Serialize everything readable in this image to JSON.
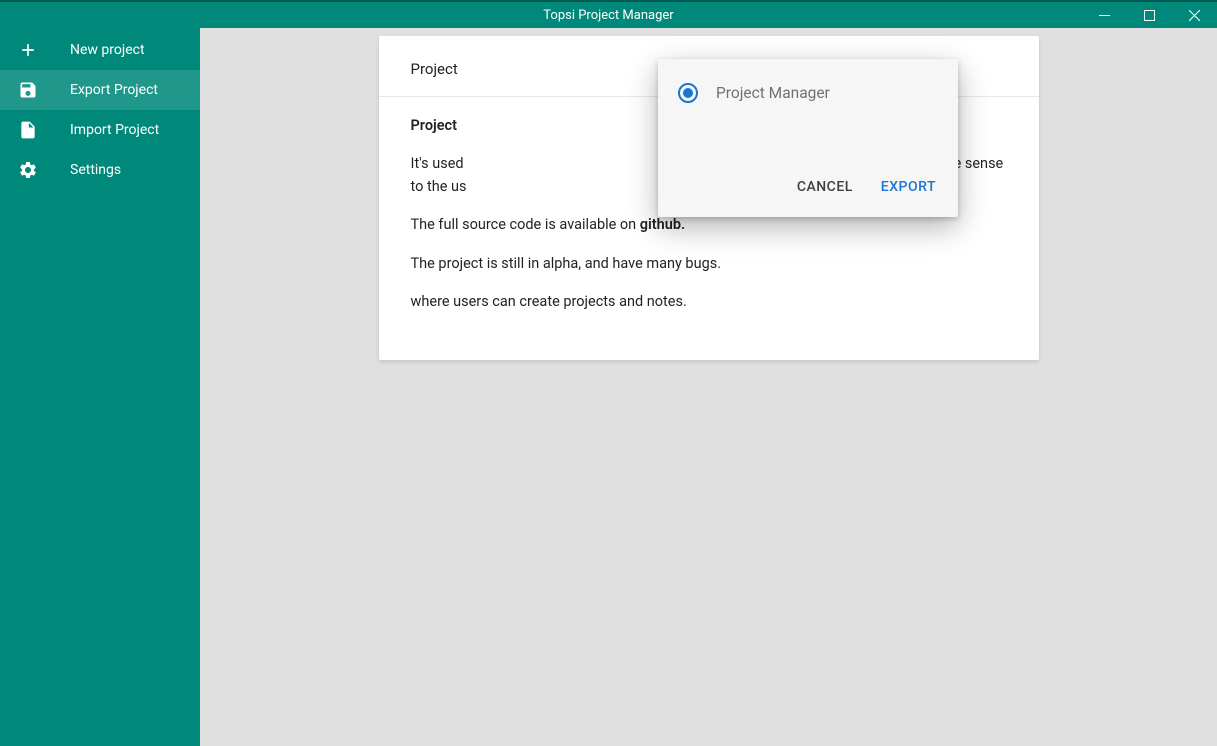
{
  "titlebar": {
    "title": "Topsi Project Manager"
  },
  "sidebar": {
    "items": [
      {
        "label": "New project"
      },
      {
        "label": "Export Project"
      },
      {
        "label": "Import Project"
      },
      {
        "label": "Settings"
      }
    ]
  },
  "card": {
    "head_partial": "Project ",
    "body": {
      "p1_strong": "Project ",
      "p1_rest": "e.",
      "p2_a": "It's used",
      "p2_b": "organize them in away that make sense to the us",
      "p3_a": "The full source code is available on ",
      "p3_strong": "github.",
      "p4": "The project is still in alpha, and have many bugs.",
      "p5": "where users can create projects and notes."
    }
  },
  "dialog": {
    "option": "Project Manager",
    "cancel": "Cancel",
    "export": "Export"
  }
}
